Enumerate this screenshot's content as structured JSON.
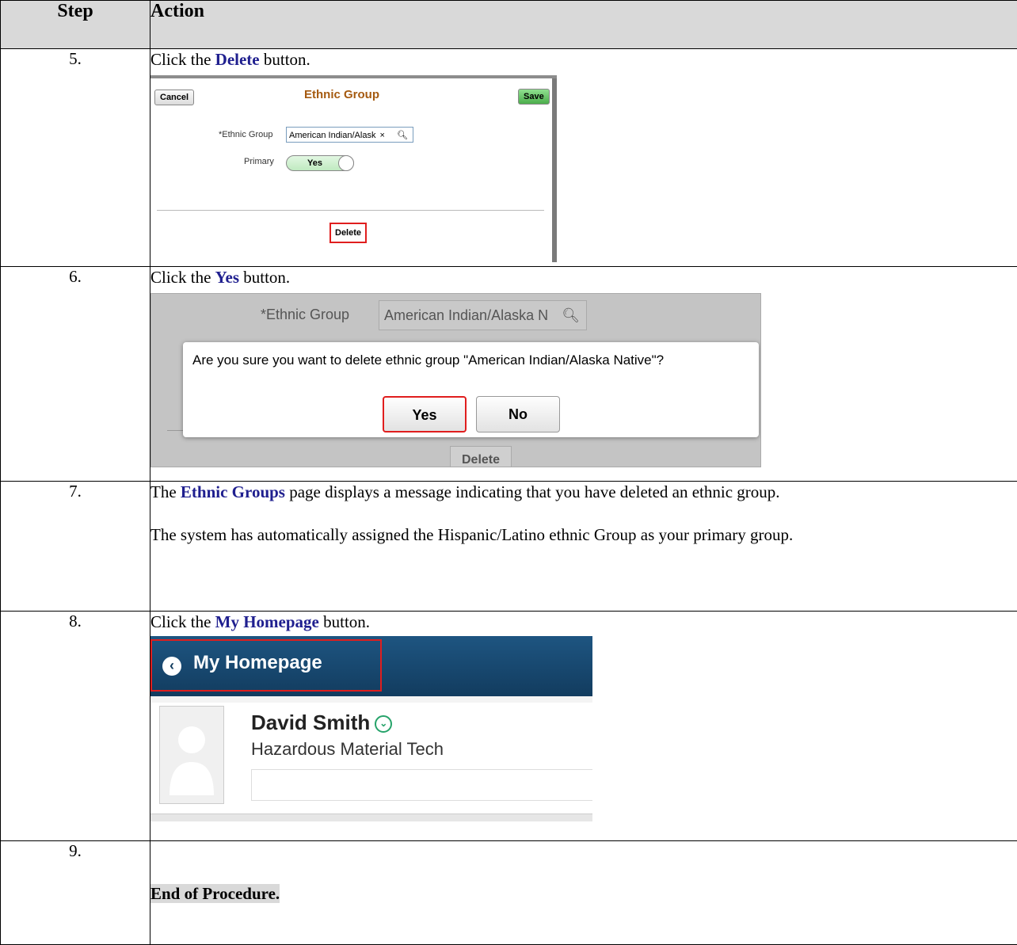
{
  "table": {
    "header": {
      "step": "Step",
      "action": "Action"
    },
    "rows": [
      {
        "step": "5.",
        "pre": "Click the ",
        "kw": "Delete",
        "post": " button."
      },
      {
        "step": "6.",
        "pre": "Click the ",
        "kw": "Yes",
        "post": " button."
      },
      {
        "step": "7.",
        "pre": "The ",
        "kw": "Ethnic Groups",
        "post": " page displays a message indicating that you have deleted an ethnic group.",
        "para2": "The system has automatically assigned the Hispanic/Latino ethnic Group as your primary group."
      },
      {
        "step": "8.",
        "pre": "Click the ",
        "kw": "My Homepage",
        "post": " button."
      },
      {
        "step": "9.",
        "end": "End of Procedure."
      }
    ]
  },
  "shot1": {
    "cancel": "Cancel",
    "title": "Ethnic Group",
    "save": "Save",
    "ethnic_label": "*Ethnic Group",
    "ethnic_value": "American Indian/Alask",
    "clear": "×",
    "primary_label": "Primary",
    "primary_value": "Yes",
    "delete": "Delete",
    "colors": {
      "title": "#a55a10",
      "save": "#5cb85c",
      "highlight": "#e01e1e"
    }
  },
  "shot2": {
    "ethnic_label": "*Ethnic Group",
    "ethnic_value": "American Indian/Alaska N",
    "question": "Are you sure you want to delete ethnic group \"American Indian/Alaska Native\"?",
    "yes": "Yes",
    "no": "No",
    "delete": "Delete"
  },
  "shot3": {
    "homepage": "My Homepage",
    "name": "David Smith",
    "job": "Hazardous Material Tech",
    "colors": {
      "bar": "#1a4a72"
    }
  }
}
